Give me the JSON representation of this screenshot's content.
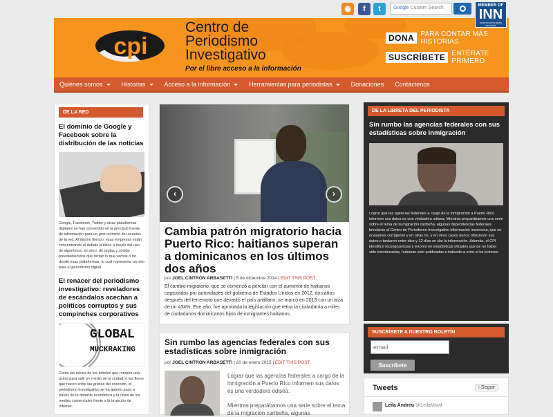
{
  "topbar": {
    "social": [
      {
        "name": "rss",
        "glyph": "◉"
      },
      {
        "name": "facebook",
        "glyph": "f"
      },
      {
        "name": "twitter",
        "glyph": "t"
      }
    ],
    "search_brand": "Google",
    "search_placeholder": "Custom Search",
    "inn_badge": {
      "line1": "MEMBER OF",
      "line2": "INN",
      "line3": "INVESTIGATIVE NEWS NETWORK"
    }
  },
  "header": {
    "logo_text": "cpi",
    "brand_lines": [
      "Centro de",
      "Periodismo",
      "Investigativo"
    ],
    "tagline": "Por el libre acceso a la información",
    "cta": [
      {
        "box": "DONA",
        "text": "PARA CONTAR MÁS HISTORIAS"
      },
      {
        "box": "SUSCRÍBETE",
        "text": "ENTÉRATE PRIMERO"
      }
    ]
  },
  "nav": [
    {
      "label": "Quiénes somos",
      "dropdown": true
    },
    {
      "label": "Historias",
      "dropdown": true
    },
    {
      "label": "Acceso a la información",
      "dropdown": true
    },
    {
      "label": "Herramientas para periodistas",
      "dropdown": true
    },
    {
      "label": "Donaciones",
      "dropdown": false
    },
    {
      "label": "Contáctenos",
      "dropdown": false
    }
  ],
  "left": {
    "label": "DE LA RED",
    "item1": {
      "title": "El dominio de Google y Facebook sobre la distribución de las noticias",
      "body": "Google, Facebook, Twitter y otras plataformas digitales se han convertido en la principal fuente de información para un gran número de usuarios de la red. Al mismo tiempo, esas empresas están concentrando el debate público a través del uso de algoritmos, es decir, de reglas y código preestablecidos que dictan lo que vemos o no desde esas plataformas, lo cual representa un reto para el periodismo digital."
    },
    "item2": {
      "title": "El renacer del periodismo investigativo: reveladores de escándalos acechan a políticos corruptos y sus compinches corporativos",
      "image_text": [
        "GLOBAL",
        "MUCKRAKING"
      ],
      "body": "Como las raíces de los árboles que rompen una acera para salir en medio de la ciudad, o las flores que nacen entre las grietas del concreto, el periodismo investigativo se ha abierto paso a través de la debacle económica y la crisis de los medios comerciales frente a la irrupción de Internet."
    }
  },
  "featured": {
    "prev": "‹",
    "next": "›",
    "title": "Cambia patrón migratorio hacia Puerto Rico: haitianos superan a dominicanos en los últimos dos años",
    "by": "por",
    "author": "JOEL CINTRÓN ARBASETTI",
    "date": "| 5 de diciembre 2014 |",
    "edit": "EDIT THIS POST",
    "body": "El cambio migratorio, que se comenzó a percibir con el aumento de haitianos capturados por autoridades del gobierno de Estados Unidos en 2012, dos años después del terremoto que devastó el país antillano, se marcó en 2013 con un alza de un 434%. Ese año, fue aprobada la legislación que retira la ciudadanía a miles de ciudadanos dominicanos hijos de inmigrantes haitianos."
  },
  "second": {
    "title": "Sin rumbo las agencias federales con sus estadísticas sobre inmigración",
    "by": "por",
    "author": "JOEL CINTRÓN ARBASETTI",
    "date": "| 20 de enero 2015 |",
    "edit": "EDIT THIS POST",
    "p1": "Lograr que las agencias federales a cargo de la inmigración a Puerto Rico informen sus datos es una verdadera odisea.",
    "p2": "Mientras preparábamos una serie sobre el tema de la migración caribeña, algunas"
  },
  "right": {
    "label": "DE LA LIBRETA DEL PERIODISTA",
    "title": "Sin rumbo las agencias federales con sus estadísticas sobre inmigración",
    "body": "Lograr que las agencias federales a cargo de la inmigración a Puerto Rico informen sus datos es una verdadera odisea. Mientras preparábamos una serie sobre el tema de la migración caribeña, algunas dependencias federales brindaron al Centro de Periodismo Investigativo información incorrecta, que en ocasiones corrigieron y en otras no, y en otros casos nunca ofrecieron sus datos o tardaron entre diez y 12 días en dar la información. Además, el CPI identificó incongruencias y errores en estadísticas oficiales que de no haber sido corroboradas, hubieran sido publicadas e inducido a error a los lectores.",
    "newsletter": {
      "label": "SUSCRÍBETE A NUESTRO BOLETÍN",
      "placeholder": "email",
      "button": "Suscríbete"
    },
    "tweets": {
      "title": "Tweets",
      "follow": "Seguir",
      "user": "Leila Andreu",
      "handle": "@LeilaMovil"
    }
  }
}
